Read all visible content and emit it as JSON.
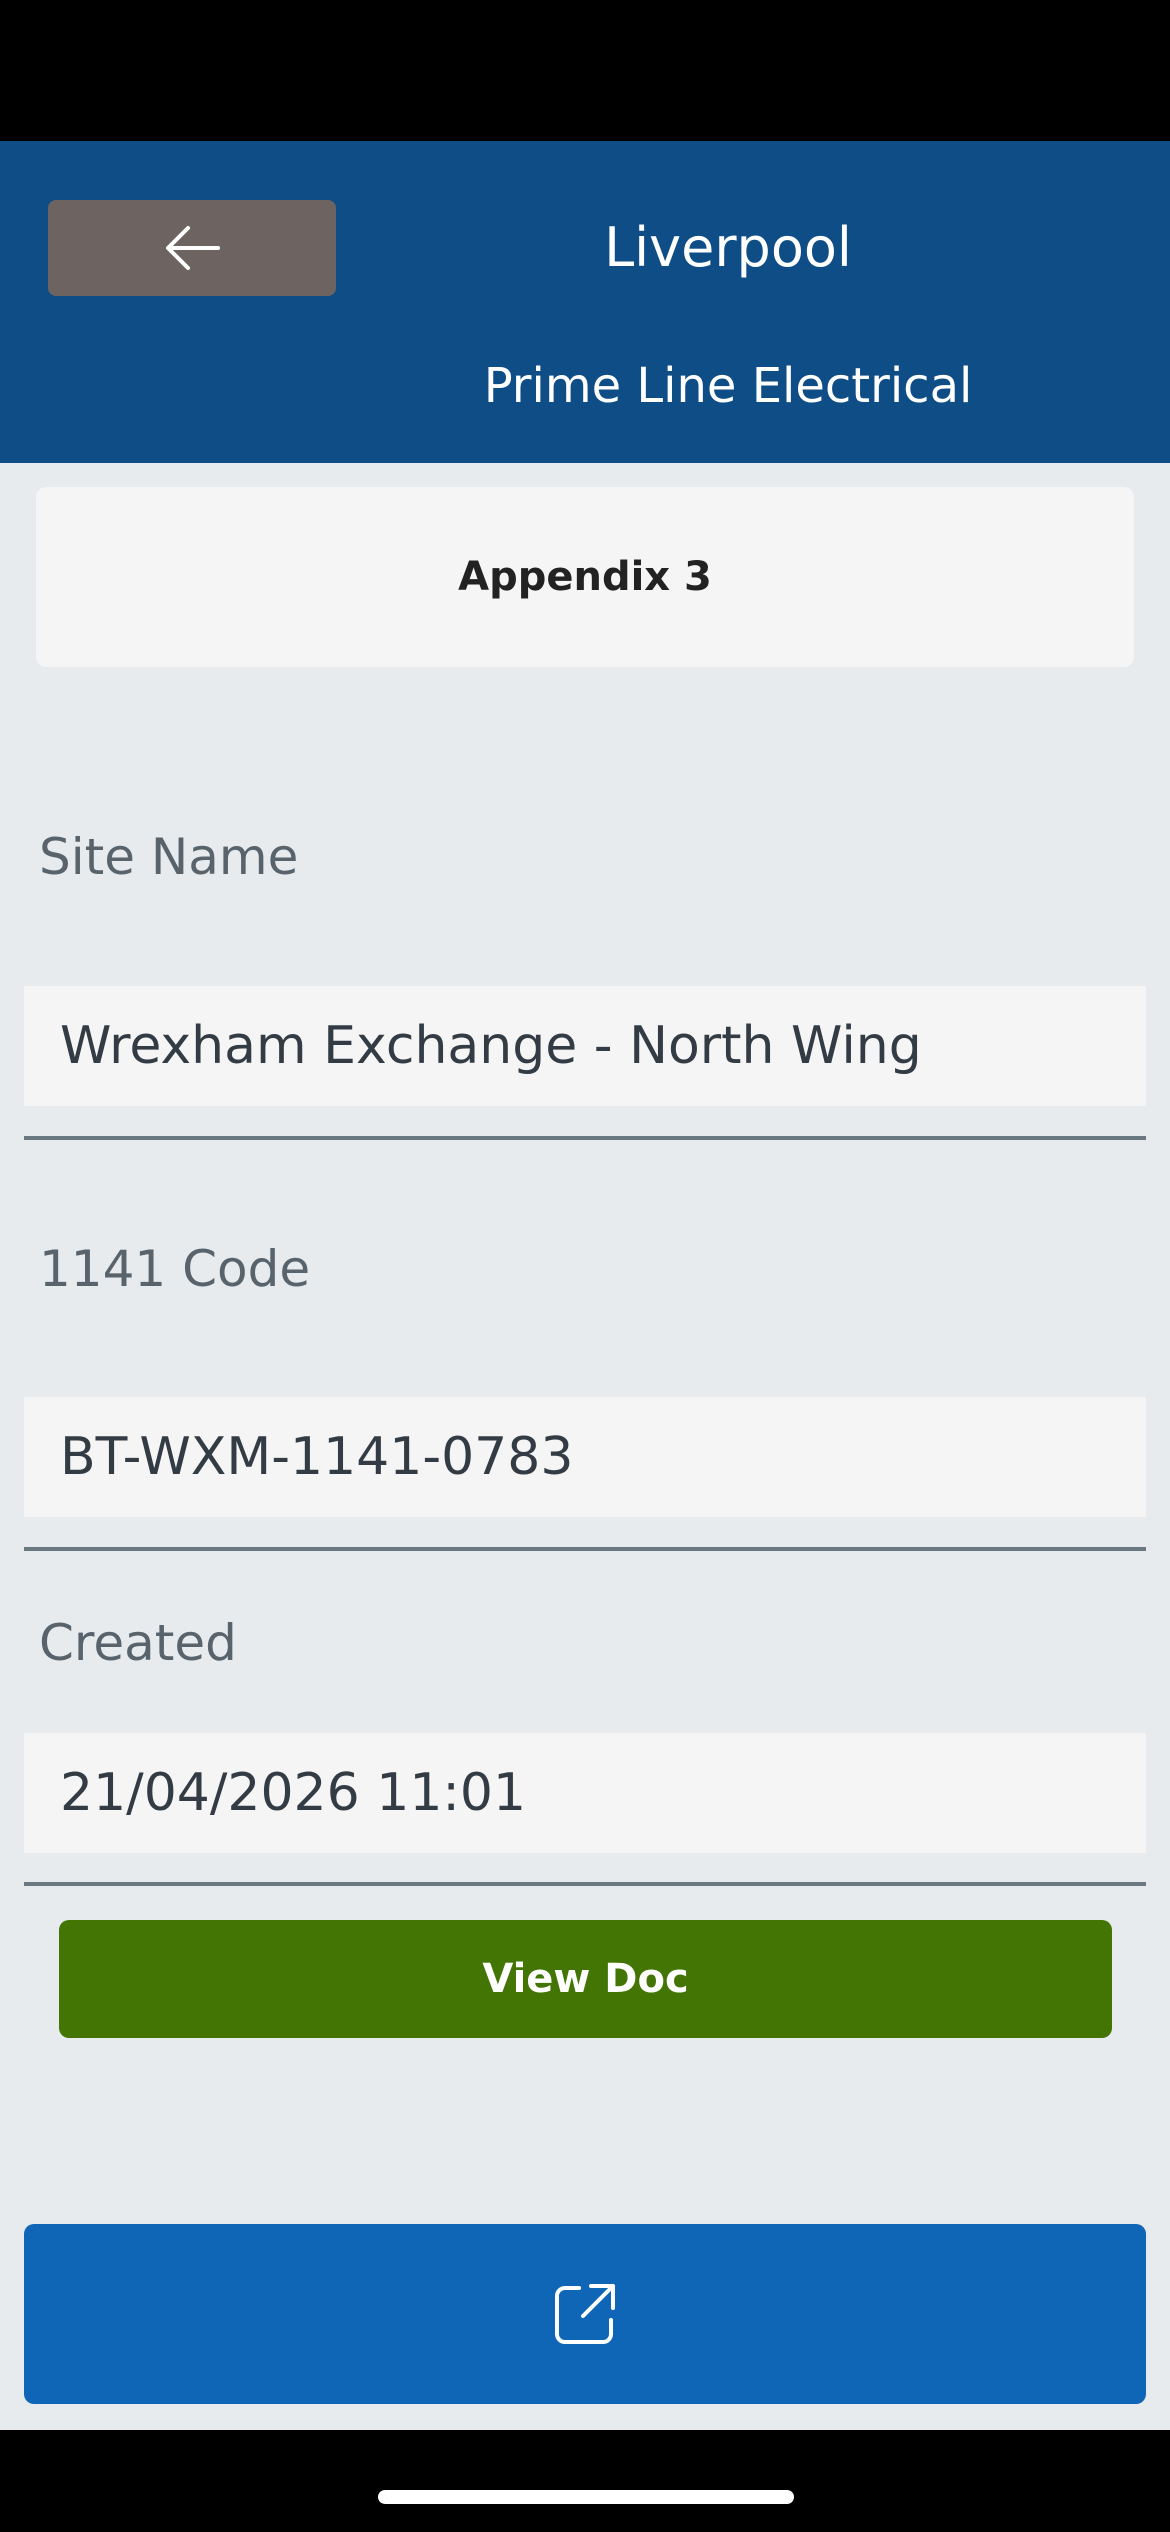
{
  "header": {
    "title": "Liverpool",
    "subtitle": "Prime Line Electrical",
    "back_icon": "arrow-left-icon"
  },
  "card": {
    "title": "Appendix 3"
  },
  "fields": {
    "site_name": {
      "label": "Site Name",
      "value": "Wrexham Exchange - North Wing"
    },
    "code_1141": {
      "label": "1141 Code",
      "value": "BT-WXM-1141-0783"
    },
    "created": {
      "label": "Created",
      "value": "21/04/2026 11:01"
    }
  },
  "actions": {
    "view_doc_label": "View Doc",
    "open_external_icon": "open-external-icon"
  },
  "colors": {
    "header_bg": "#0f4d86",
    "back_button_bg": "#6d6462",
    "view_doc_bg": "#427503",
    "open_button_bg": "#0f66b6",
    "page_bg": "#e7ebee"
  }
}
